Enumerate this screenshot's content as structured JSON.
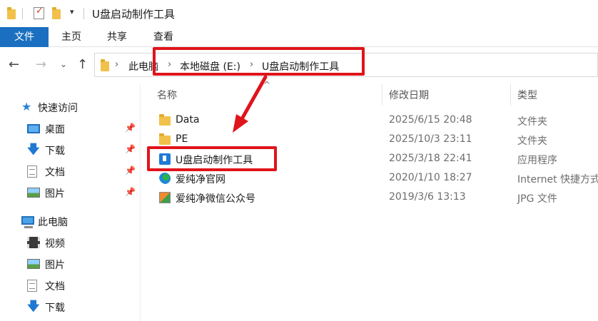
{
  "window": {
    "title": "U盘启动制作工具",
    "quick_access_dropdown": "▾"
  },
  "ribbon": {
    "tabs": [
      {
        "label": "文件",
        "active": true
      },
      {
        "label": "主页"
      },
      {
        "label": "共享"
      },
      {
        "label": "查看"
      }
    ]
  },
  "navigation": {
    "back": "←",
    "forward": "→",
    "recent": "⌄",
    "up": "↑",
    "breadcrumb": [
      "此电脑",
      "本地磁盘 (E:)",
      "U盘启动制作工具"
    ],
    "separator": "›"
  },
  "sidebar": {
    "quick_access": {
      "label": "快速访问",
      "icon": "star-icon",
      "items": [
        {
          "label": "桌面",
          "icon": "desktop-icon",
          "pinned": true
        },
        {
          "label": "下载",
          "icon": "download-icon",
          "pinned": true
        },
        {
          "label": "文档",
          "icon": "document-icon",
          "pinned": true
        },
        {
          "label": "图片",
          "icon": "pictures-icon",
          "pinned": true
        }
      ]
    },
    "this_pc": {
      "label": "此电脑",
      "icon": "computer-icon",
      "items": [
        {
          "label": "视频",
          "icon": "video-icon"
        },
        {
          "label": "图片",
          "icon": "pictures-icon"
        },
        {
          "label": "文档",
          "icon": "document-icon"
        },
        {
          "label": "下载",
          "icon": "download-icon"
        }
      ]
    },
    "pin_glyph": "📌"
  },
  "file_list": {
    "columns": [
      "名称",
      "修改日期",
      "类型"
    ],
    "sort_indicator": "^",
    "rows": [
      {
        "name": "Data",
        "date": "2025/6/15 20:48",
        "type": "文件夹",
        "icon": "folder-icon"
      },
      {
        "name": "PE",
        "date": "2025/10/3 23:11",
        "type": "文件夹",
        "icon": "folder-icon"
      },
      {
        "name": "U盘启动制作工具",
        "date": "2025/3/18 22:41",
        "type": "应用程序",
        "icon": "usb-app-icon"
      },
      {
        "name": "爱纯净官网",
        "date": "2020/1/10 18:27",
        "type": "Internet 快捷方式",
        "icon": "internet-shortcut-icon"
      },
      {
        "name": "爱纯净微信公众号",
        "date": "2019/3/6 13:13",
        "type": "JPG 文件",
        "icon": "jpg-image-icon"
      }
    ]
  },
  "annotations": {
    "color": "#e0141b"
  }
}
